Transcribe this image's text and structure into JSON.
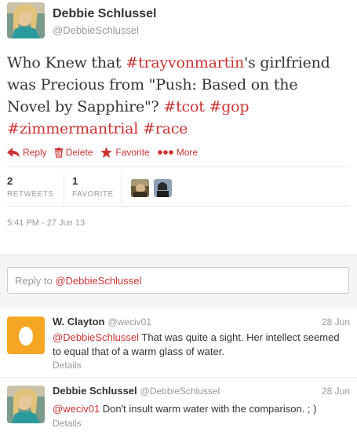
{
  "tweet": {
    "author_name": "Debbie Schlussel",
    "author_handle": "@DebbieSchlussel",
    "text_1": "Who Knew that ",
    "hashtag_1": "#trayvonmartin",
    "text_2": "'s girlfriend was Precious from \"Push: Based on the Novel by Sapphire\"? ",
    "hashtag_2": "#tcot",
    "hashtag_3": "#gop",
    "hashtag_4": "#zimmermantrial",
    "hashtag_5": "#race",
    "actions": {
      "reply": "Reply",
      "delete": "Delete",
      "favorite": "Favorite",
      "more": "More"
    },
    "stats": {
      "retweets_count": "2",
      "retweets_label": "RETWEETS",
      "favorites_count": "1",
      "favorites_label": "FAVORITE"
    },
    "timestamp": "5:41 PM - 27 Jun 13"
  },
  "reply_box": {
    "prefix": "Reply to ",
    "mention": "@DebbieSchlussel"
  },
  "replies": [
    {
      "name": "W. Clayton",
      "handle": "@weciv01",
      "date": "28 Jun",
      "mention": "@DebbieSchlussel",
      "text": "  That was quite a sight.  Her intellect seemed to equal that of a warm glass of water.",
      "details": "Details"
    },
    {
      "name": "Debbie Schlussel",
      "handle": "@DebbieSchlussel",
      "date": "28 Jun",
      "mention": "@weciv01",
      "text": " Don't insult warm water with the comparison.  ;  )",
      "details": "Details"
    }
  ],
  "colors": {
    "accent": "#cc3333",
    "muted": "#999999",
    "text": "#333333"
  }
}
